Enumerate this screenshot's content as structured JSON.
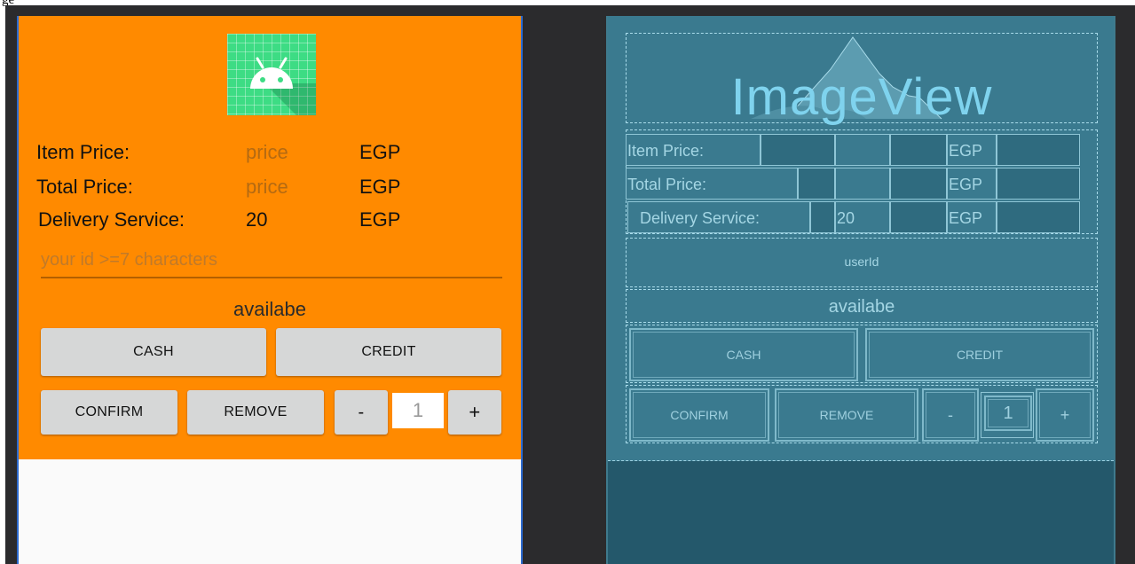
{
  "topbar": {
    "text": "ge"
  },
  "design": {
    "colors": {
      "background": "#ff8a00",
      "button": "#d6d7d7"
    },
    "icon": "android-app-icon",
    "rows": [
      {
        "label": "Item Price:",
        "value": "price",
        "currency": "EGP"
      },
      {
        "label": "Total Price:",
        "value": "price",
        "currency": "EGP"
      },
      {
        "label": "Delivery Service:",
        "value": "20",
        "currency": "EGP"
      }
    ],
    "user_id_input": {
      "placeholder": "your id >=7 characters"
    },
    "availability": "availabe",
    "buttons": {
      "cash": "CASH",
      "credit": "CREDIT",
      "confirm": "CONFIRM",
      "remove": "REMOVE",
      "minus": "-",
      "plus": "+"
    },
    "quantity": "1"
  },
  "blueprint": {
    "image_view": "ImageView",
    "rows": [
      {
        "label": "Item Price:",
        "value": "",
        "currency": "EGP"
      },
      {
        "label": "Total Price:",
        "value": "",
        "currency": "EGP"
      },
      {
        "label": "Delivery Service:",
        "value": "20",
        "currency": "EGP"
      }
    ],
    "user_id": "userId",
    "availability": "availabe",
    "buttons": {
      "cash": "CASH",
      "credit": "CREDIT",
      "confirm": "CONFIRM",
      "remove": "REMOVE",
      "minus": "-",
      "plus": "+"
    },
    "quantity": "1"
  }
}
